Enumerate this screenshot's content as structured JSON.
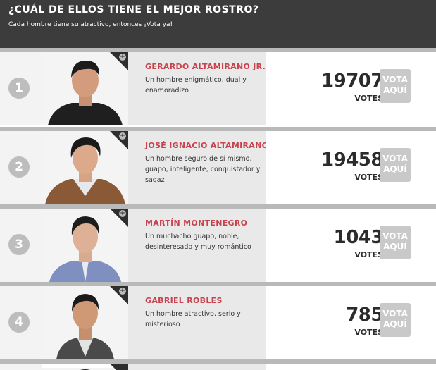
{
  "header": {
    "title": "¿CUÁL DE ELLOS TIENE EL MEJOR ROSTRO?",
    "subtitle": "Cada hombre tiene su atractivo, entonces ¡Vota ya!"
  },
  "votes_label": "VOTES",
  "vote_button_line1": "VOTA",
  "vote_button_line2": "AQUÍ",
  "photo_badge": "+",
  "candidates": [
    {
      "rank": "1",
      "name": "GERARDO ALTAMIRANO JR.",
      "description": "Un hombre enigmático, dual y enamoradizo",
      "votes": "19707",
      "photo_icon": "man-portrait-black-shirt"
    },
    {
      "rank": "2",
      "name": "JOSÉ IGNACIO ALTAMIRANO",
      "description": "Un hombre seguro de sí mismo, guapo, inteligente, conquistador y sagaz",
      "votes": "19458",
      "photo_icon": "man-portrait-brown-jacket"
    },
    {
      "rank": "3",
      "name": "MARTÍN MONTENEGRO",
      "description": "Un muchacho guapo, noble, desinteresado y muy romántico",
      "votes": "1043",
      "photo_icon": "man-portrait-blue-shirt"
    },
    {
      "rank": "4",
      "name": "GABRIEL ROBLES",
      "description": "Un hombre atractivo, serio y misterioso",
      "votes": "785",
      "photo_icon": "man-portrait-vest"
    }
  ]
}
